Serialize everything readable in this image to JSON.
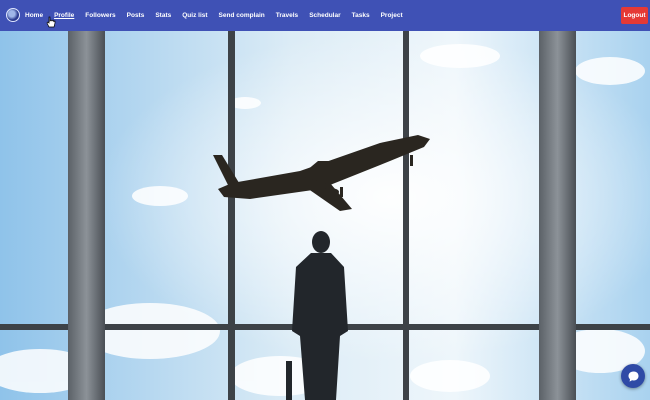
{
  "navbar": {
    "brand_icon": "globe-logo-icon",
    "links": [
      {
        "label": "Home"
      },
      {
        "label": "Profile"
      },
      {
        "label": "Followers"
      },
      {
        "label": "Posts"
      },
      {
        "label": "Stats"
      },
      {
        "label": "Quiz list"
      },
      {
        "label": "Send complain"
      },
      {
        "label": "Travels"
      },
      {
        "label": "Schedular"
      },
      {
        "label": "Tasks"
      },
      {
        "label": "Project"
      }
    ],
    "logout_label": "Logout"
  },
  "chat": {
    "icon": "chat-bubble-icon"
  },
  "colors": {
    "navbar_bg": "#3f51b5",
    "logout_bg": "#e53935",
    "chat_bg": "#2f4aa6"
  }
}
